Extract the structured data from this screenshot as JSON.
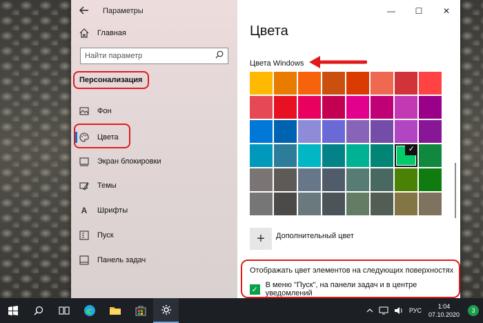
{
  "window": {
    "app_title": "Параметры",
    "controls": {
      "minimize": "—",
      "maximize": "☐",
      "close": "✕"
    }
  },
  "sidebar": {
    "home_label": "Главная",
    "search_placeholder": "Найти параметр",
    "section_title": "Персонализация",
    "items": [
      {
        "label": "Фон",
        "icon": "image-icon"
      },
      {
        "label": "Цвета",
        "icon": "palette-icon",
        "active": true
      },
      {
        "label": "Экран блокировки",
        "icon": "lock-screen-icon"
      },
      {
        "label": "Темы",
        "icon": "themes-icon"
      },
      {
        "label": "Шрифты",
        "icon": "font-icon"
      },
      {
        "label": "Пуск",
        "icon": "start-icon"
      },
      {
        "label": "Панель задач",
        "icon": "taskbar-icon"
      }
    ]
  },
  "content": {
    "page_title": "Цвета",
    "windows_colors_label": "Цвета Windows",
    "swatches": [
      [
        "#ffb900",
        "#e77c00",
        "#f7630c",
        "#ca5010",
        "#da3b01",
        "#ef6950",
        "#d13438",
        "#ff4343"
      ],
      [
        "#e74856",
        "#e81123",
        "#ea005e",
        "#c30052",
        "#e3008c",
        "#bf0077",
        "#c239b3",
        "#9a0089"
      ],
      [
        "#0078d7",
        "#0063b1",
        "#8e8cd8",
        "#6b69d6",
        "#8764b8",
        "#744da9",
        "#b146c2",
        "#881798"
      ],
      [
        "#0099bc",
        "#2d7d9a",
        "#00b7c3",
        "#038387",
        "#00b294",
        "#018574",
        "#00cc6a",
        "#10893e"
      ],
      [
        "#7a7574",
        "#5d5a58",
        "#68768a",
        "#515c6b",
        "#567c73",
        "#486860",
        "#498205",
        "#107c10"
      ],
      [
        "#767676",
        "#4c4a48",
        "#69797e",
        "#4a5459",
        "#647c64",
        "#525e54",
        "#847545",
        "#7e735f"
      ]
    ],
    "selected_swatch": {
      "row": 3,
      "col": 6
    },
    "add_color_label": "Дополнительный цвет",
    "surfaces_title": "Отображать цвет элементов на следующих поверхностях",
    "surfaces_checkbox_label": "В меню \"Пуск\", на панели задач и в центре уведомлений",
    "surfaces_checked": true
  },
  "taskbar": {
    "language": "РУС",
    "time": "1:04",
    "date": "07.10.2020",
    "notifications_count": "3"
  },
  "colors": {
    "accent": "#0078d7",
    "annotation_red": "#e11b1b",
    "checkbox_green": "#0aa04a"
  }
}
